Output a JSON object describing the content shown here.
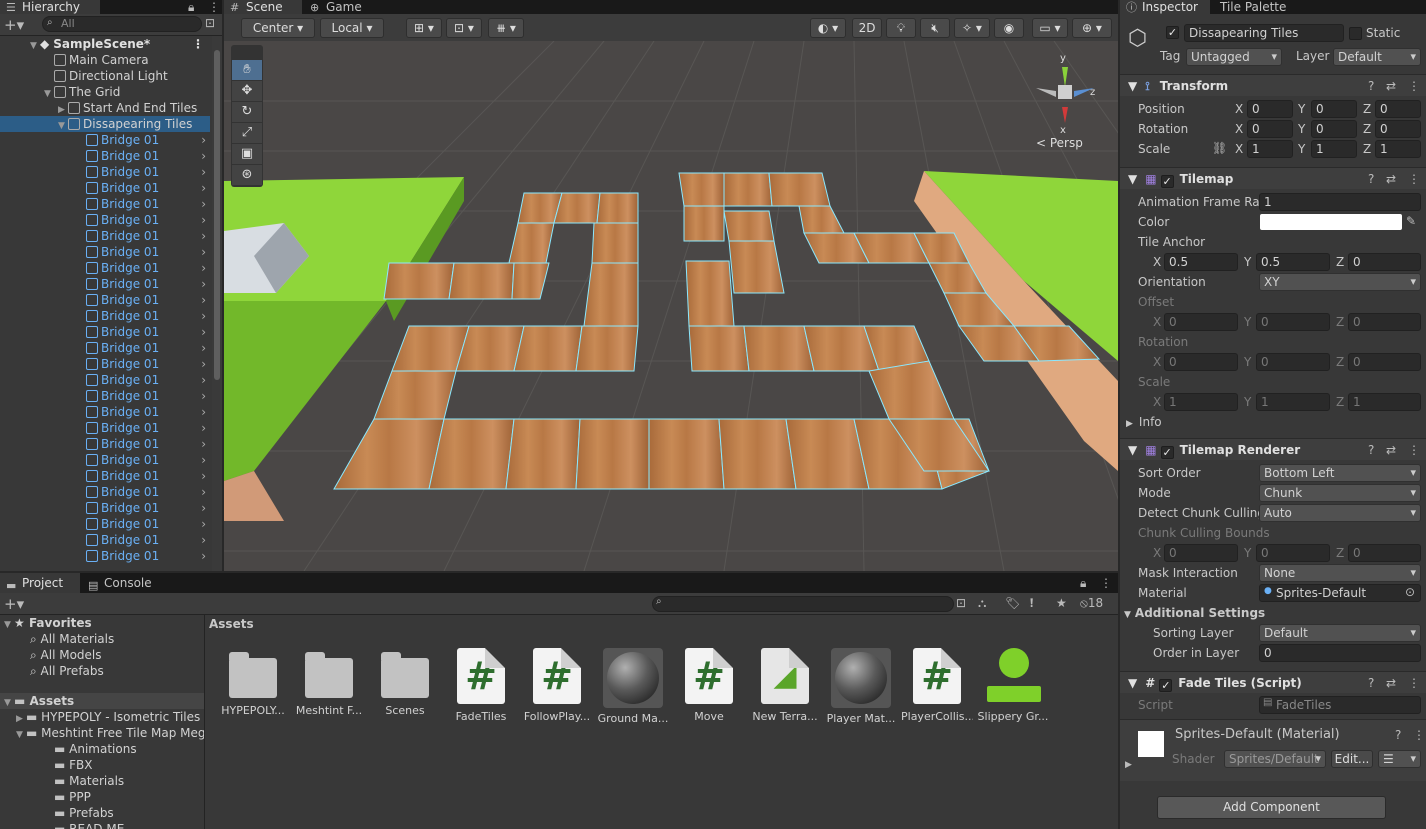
{
  "hierarchy": {
    "tab": "Hierarchy",
    "search_placeholder": "All",
    "scene": "SampleScene*",
    "items": [
      {
        "label": "Main Camera",
        "indent": 1
      },
      {
        "label": "Directional Light",
        "indent": 1
      },
      {
        "label": "The Grid",
        "indent": 1
      },
      {
        "label": "Start And End Tiles",
        "indent": 2
      },
      {
        "label": "Dissapearing Tiles",
        "indent": 2
      }
    ],
    "child_label": "Bridge 01",
    "child_count": 27
  },
  "scene_view": {
    "tabs": [
      "Scene",
      "Game"
    ],
    "pivot": "Center",
    "space": "Local",
    "mode_2d": "2D",
    "persp": "< Persp",
    "gizmo_axes": [
      "y",
      "z",
      "x"
    ],
    "hidden_count": "18"
  },
  "inspector": {
    "tabs": [
      "Inspector",
      "Tile Palette"
    ],
    "object_name": "Dissapearing Tiles",
    "static_label": "Static",
    "tag_label": "Tag",
    "tag_value": "Untagged",
    "layer_label": "Layer",
    "layer_value": "Default",
    "transform": {
      "title": "Transform",
      "position_label": "Position",
      "position": [
        "0",
        "0",
        "0"
      ],
      "rotation_label": "Rotation",
      "rotation": [
        "0",
        "0",
        "0"
      ],
      "scale_label": "Scale",
      "scale": [
        "1",
        "1",
        "1"
      ]
    },
    "tilemap": {
      "title": "Tilemap",
      "anim_label": "Animation Frame Rate",
      "anim_value": "1",
      "color_label": "Color",
      "anchor_label": "Tile Anchor",
      "anchor": [
        "0.5",
        "0.5",
        "0"
      ],
      "orientation_label": "Orientation",
      "orientation": "XY",
      "offset_label": "Offset",
      "offset": [
        "0",
        "0",
        "0"
      ],
      "rot_label": "Rotation",
      "rot": [
        "0",
        "0",
        "0"
      ],
      "scale_label": "Scale",
      "scale": [
        "1",
        "1",
        "1"
      ],
      "info_label": "Info"
    },
    "renderer": {
      "title": "Tilemap Renderer",
      "sort_label": "Sort Order",
      "sort_value": "Bottom Left",
      "mode_label": "Mode",
      "mode_value": "Chunk",
      "cull_label": "Detect Chunk Culling",
      "cull_value": "Auto",
      "bounds_label": "Chunk Culling Bounds",
      "bounds": [
        "0",
        "0",
        "0"
      ],
      "mask_label": "Mask Interaction",
      "mask_value": "None",
      "material_label": "Material",
      "material_value": "Sprites-Default",
      "additional_label": "Additional Settings",
      "sorting_layer_label": "Sorting Layer",
      "sorting_layer_value": "Default",
      "order_label": "Order in Layer",
      "order_value": "0"
    },
    "fade": {
      "title": "Fade Tiles (Script)",
      "script_label": "Script",
      "script_value": "FadeTiles"
    },
    "material_block": {
      "title": "Sprites-Default (Material)",
      "shader_label": "Shader",
      "shader_value": "Sprites/Default",
      "edit_label": "Edit..."
    },
    "add_component": "Add Component",
    "xyz": [
      "X",
      "Y",
      "Z"
    ]
  },
  "project": {
    "tabs": [
      "Project",
      "Console"
    ],
    "favorites_label": "Favorites",
    "favorites": [
      "All Materials",
      "All Models",
      "All Prefabs"
    ],
    "assets_label": "Assets",
    "tree": [
      {
        "label": "HYPEPOLY - Isometric Tiles",
        "indent": 1
      },
      {
        "label": "Meshtint Free Tile Map Meg",
        "indent": 1
      },
      {
        "label": "Animations",
        "indent": 2
      },
      {
        "label": "FBX",
        "indent": 2
      },
      {
        "label": "Materials",
        "indent": 2
      },
      {
        "label": "PPP",
        "indent": 2
      },
      {
        "label": "Prefabs",
        "indent": 2
      },
      {
        "label": "READ ME",
        "indent": 2
      }
    ],
    "breadcrumb": "Assets",
    "assets": [
      {
        "label": "HYPEPOLY...",
        "kind": "folder"
      },
      {
        "label": "Meshtint F...",
        "kind": "folder"
      },
      {
        "label": "Scenes",
        "kind": "folder"
      },
      {
        "label": "FadeTiles",
        "kind": "script"
      },
      {
        "label": "FollowPlay...",
        "kind": "script"
      },
      {
        "label": "Ground Ma...",
        "kind": "material"
      },
      {
        "label": "Move",
        "kind": "script"
      },
      {
        "label": "New Terra...",
        "kind": "terrain"
      },
      {
        "label": "Player Mat...",
        "kind": "material"
      },
      {
        "label": "PlayerCollis...",
        "kind": "script"
      },
      {
        "label": "Slippery Gr...",
        "kind": "physics"
      }
    ]
  }
}
